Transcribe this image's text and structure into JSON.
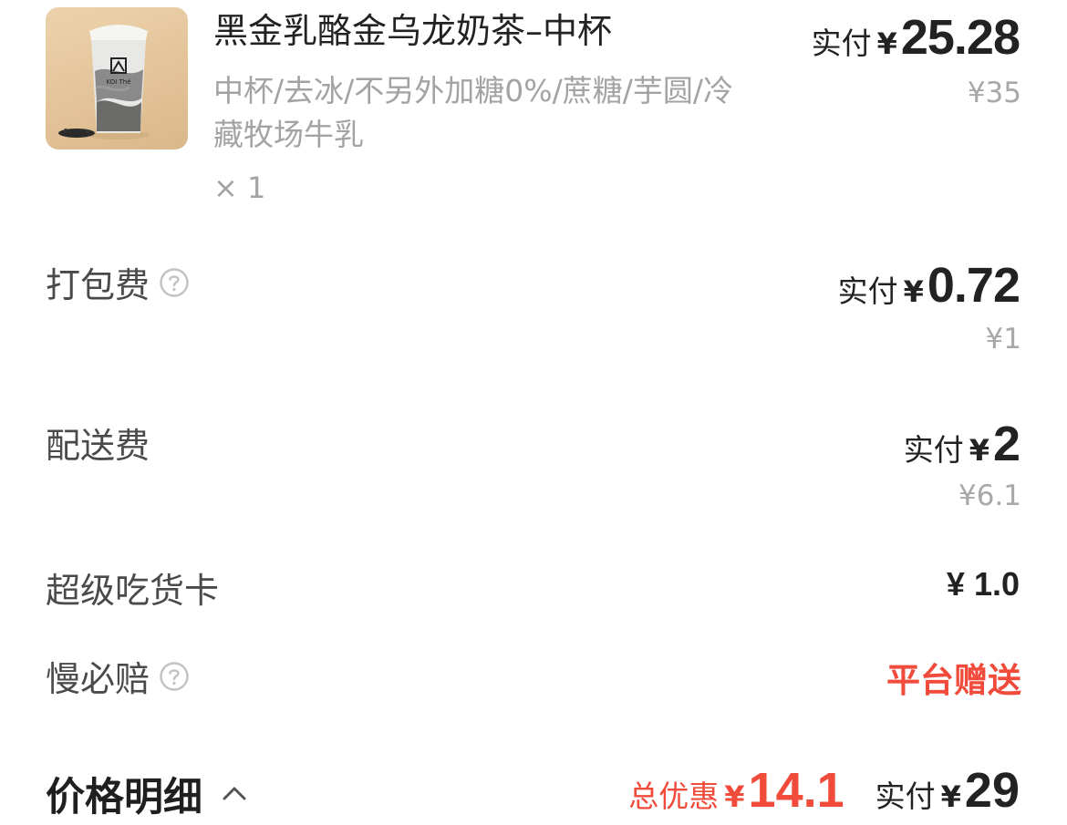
{
  "product": {
    "image_icon": "milk-tea-cup-image",
    "cup_brand_text": "KOI Thé",
    "name": "黑金乳酪金乌龙奶茶–中杯",
    "specs": "中杯/去冰/不另外加糖0%/蔗糖/芋圆/冷藏牧场牛乳",
    "quantity": "× 1",
    "paid_label": "实付",
    "paid_currency": "¥",
    "paid_amount": "25.28",
    "original_price": "¥35"
  },
  "packing_fee": {
    "label": "打包费",
    "icon": "help-circle-icon",
    "paid_label": "实付",
    "paid_currency": "¥",
    "paid_amount": "0.72",
    "original_price": "¥1"
  },
  "delivery_fee": {
    "label": "配送费",
    "paid_label": "实付",
    "paid_currency": "¥",
    "paid_amount": "2",
    "original_price": "¥6.1"
  },
  "super_card": {
    "label": "超级吃货卡",
    "value": "¥ 1.0"
  },
  "late_guarantee": {
    "label": "慢必赔",
    "icon": "help-circle-icon",
    "value": "平台赠送"
  },
  "price_detail": {
    "title": "价格明细",
    "toggle_icon": "chevron-up-icon",
    "discount_label": "总优惠",
    "discount_currency": "¥",
    "discount_amount": "14.1",
    "total_label": "实付",
    "total_currency": "¥",
    "total_amount": "29"
  },
  "colors": {
    "accent_red": "#f04b3b",
    "text_primary": "#222222",
    "text_secondary": "#a3a3a3"
  }
}
